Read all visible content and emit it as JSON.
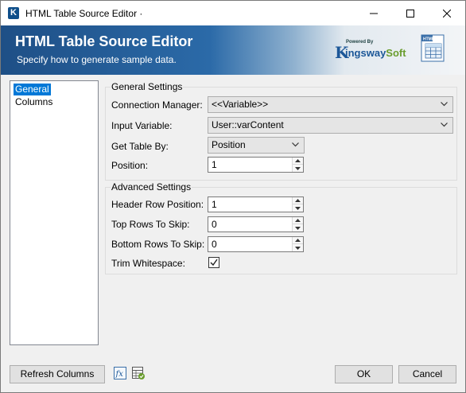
{
  "window": {
    "title": "HTML Table Source Editor ·",
    "app_icon_letter": "K"
  },
  "banner": {
    "title": "HTML Table Source Editor",
    "subtitle": "Specify how to generate sample data.",
    "logo": {
      "powered_by": "Powered By",
      "brand_initial": "K",
      "brand_mid": "ingsway",
      "brand_end": "Soft"
    },
    "html_icon_label": "HTML"
  },
  "nav": {
    "items": [
      {
        "label": "General",
        "selected": true
      },
      {
        "label": "Columns",
        "selected": false
      }
    ]
  },
  "general_settings": {
    "title": "General Settings",
    "connection_manager": {
      "label": "Connection Manager:",
      "value": "<<Variable>>"
    },
    "input_variable": {
      "label": "Input Variable:",
      "value": "User::varContent"
    },
    "get_table_by": {
      "label": "Get Table By:",
      "value": "Position"
    },
    "position": {
      "label": "Position:",
      "value": "1"
    }
  },
  "advanced_settings": {
    "title": "Advanced Settings",
    "header_row_position": {
      "label": "Header Row Position:",
      "value": "1"
    },
    "top_rows_to_skip": {
      "label": "Top Rows To Skip:",
      "value": "0"
    },
    "bottom_rows_to_skip": {
      "label": "Bottom Rows To Skip:",
      "value": "0"
    },
    "trim_whitespace": {
      "label": "Trim Whitespace:",
      "checked": true
    }
  },
  "footer": {
    "refresh_label": "Refresh Columns",
    "ok_label": "OK",
    "cancel_label": "Cancel",
    "fx_icon_text": "fx"
  },
  "colors": {
    "selection": "#0078d7",
    "banner_dark": "#1e4f86",
    "brand_blue": "#1c5798",
    "brand_green": "#6a9d2e"
  }
}
